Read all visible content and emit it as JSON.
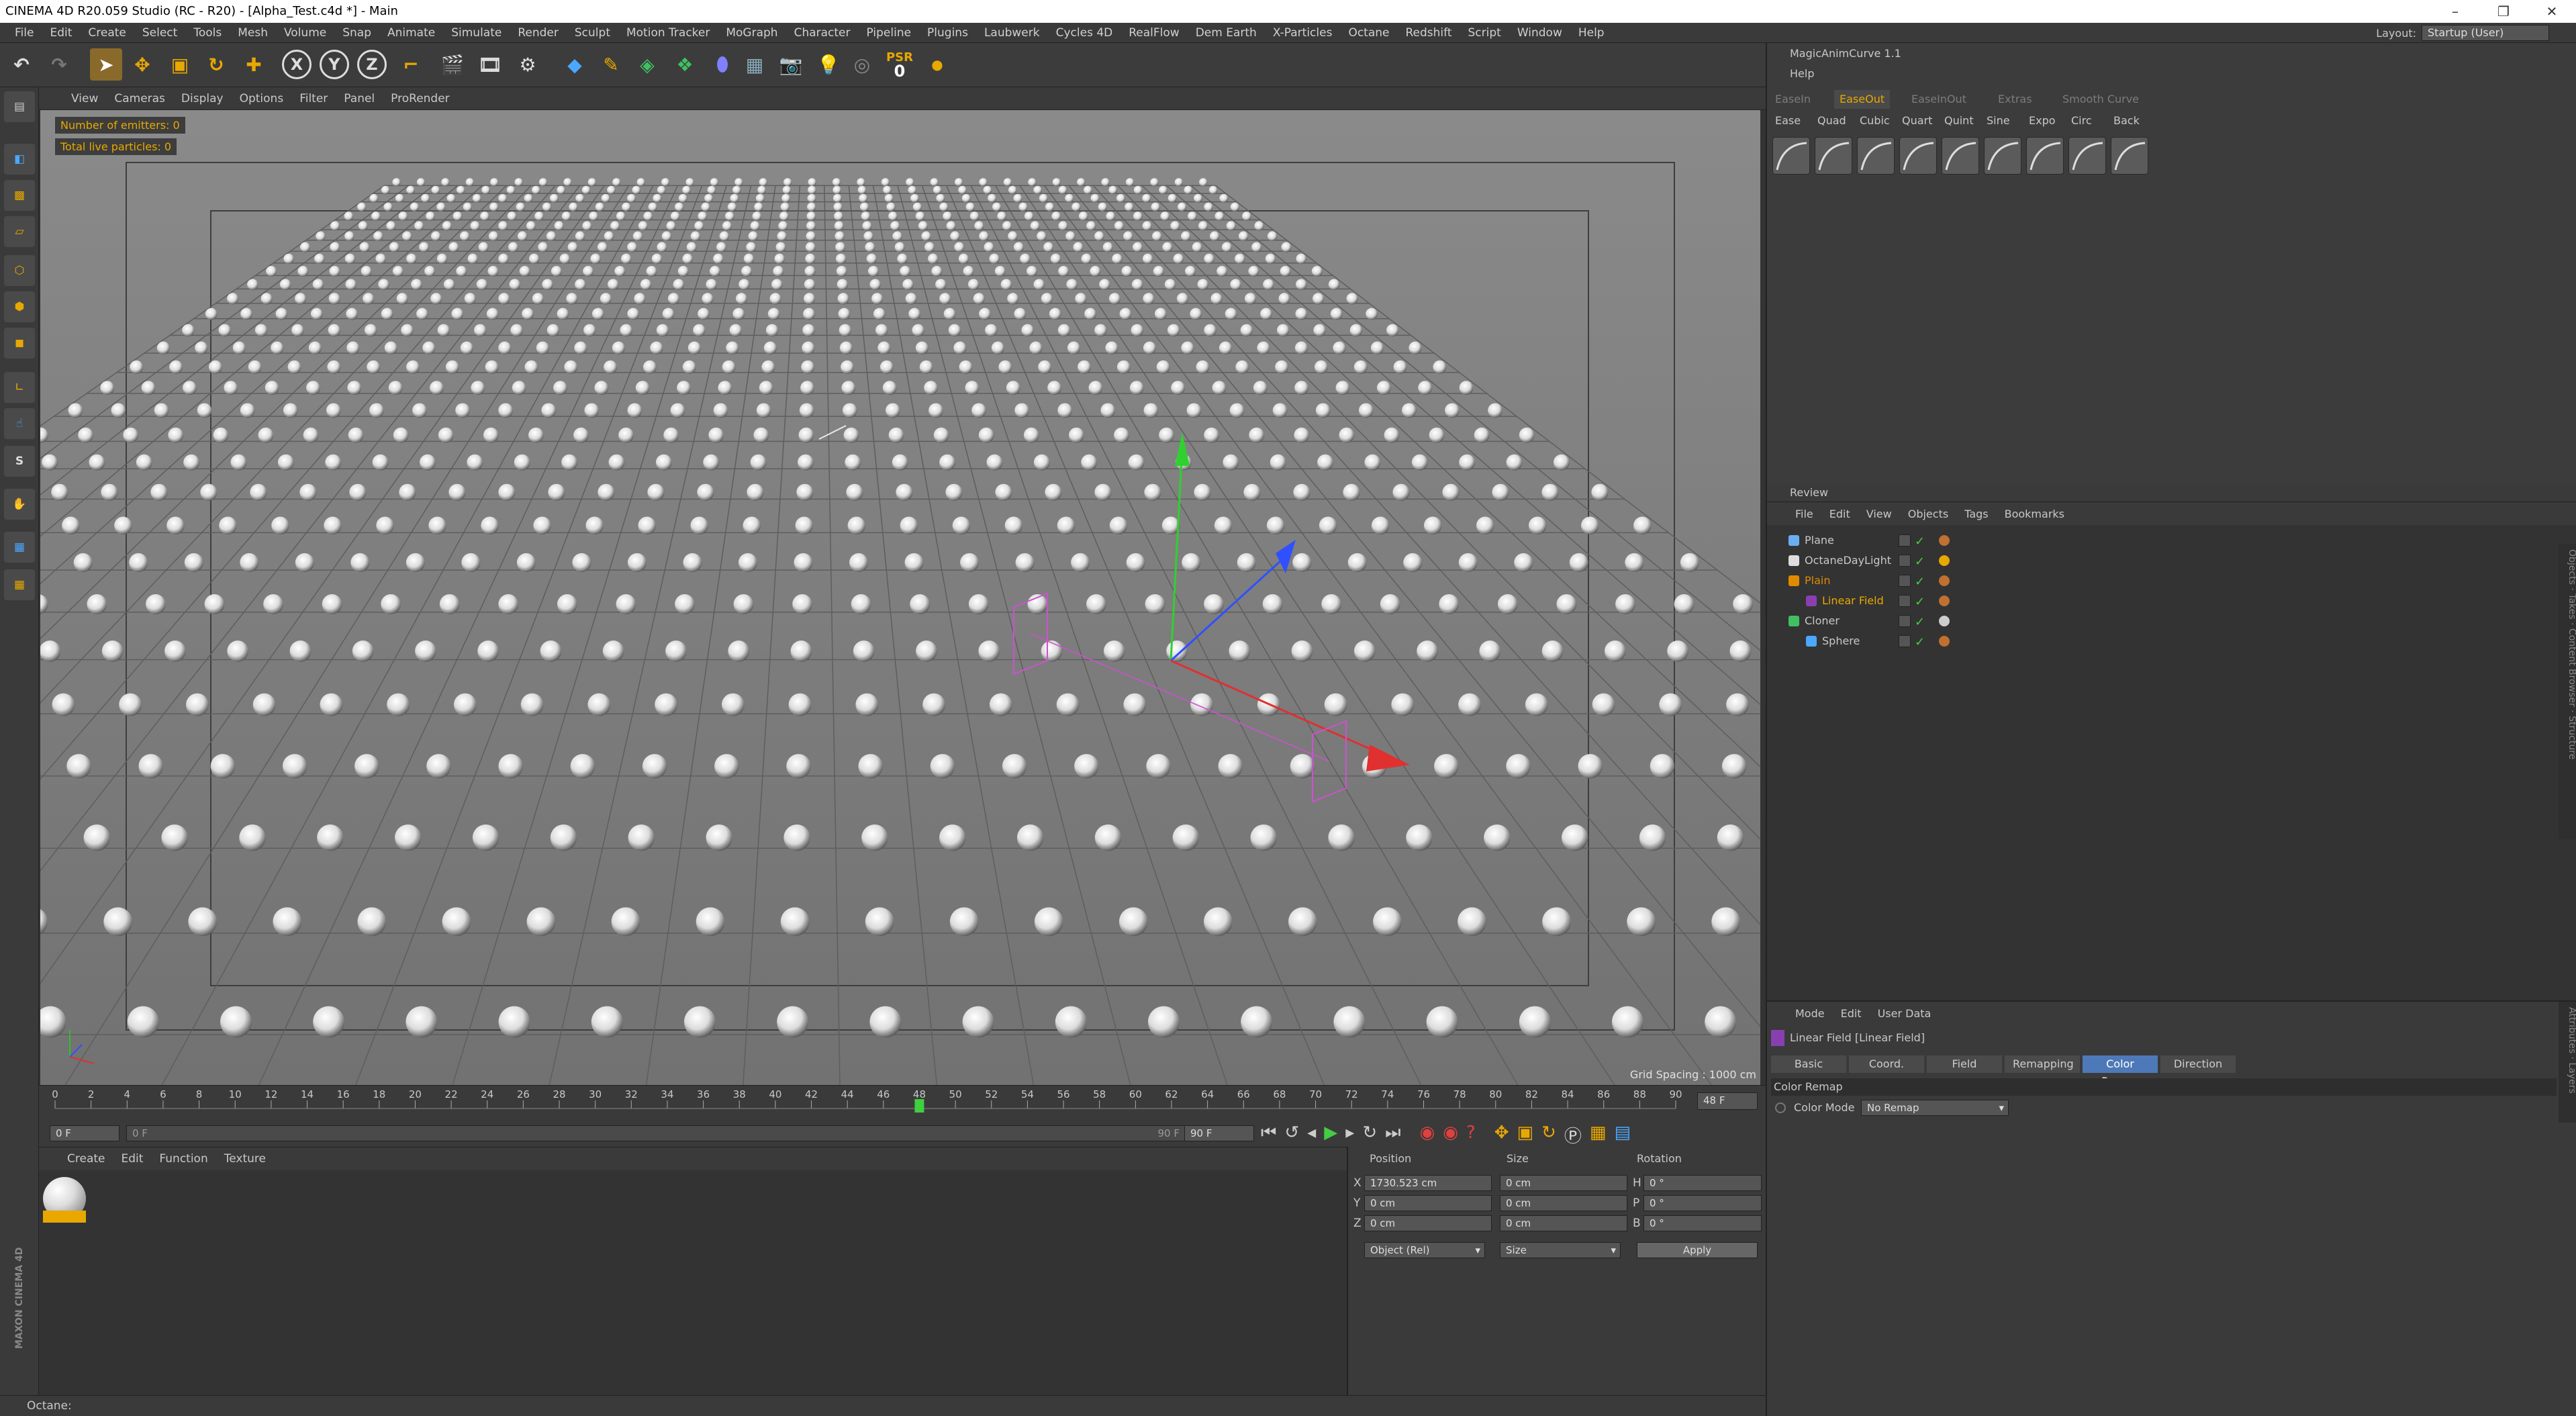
{
  "app": {
    "title": "CINEMA 4D R20.059 Studio (RC - R20) - [Alpha_Test.c4d *] - Main",
    "layout_label": "Layout:",
    "layout_value": "Startup (User)"
  },
  "menu": [
    "File",
    "Edit",
    "Create",
    "Select",
    "Tools",
    "Mesh",
    "Volume",
    "Snap",
    "Animate",
    "Simulate",
    "Render",
    "Sculpt",
    "Motion Tracker",
    "MoGraph",
    "Character",
    "Pipeline",
    "Plugins",
    "Laubwerk",
    "Cycles 4D",
    "RealFlow",
    "Dem Earth",
    "X-Particles",
    "Octane",
    "Redshift",
    "Script",
    "Window",
    "Help"
  ],
  "toolbar": {
    "psr_label": "PSR",
    "psr_value": "0"
  },
  "viewport": {
    "menu": [
      "View",
      "Cameras",
      "Display",
      "Options",
      "Filter",
      "Panel",
      "ProRender"
    ],
    "hud_emitters": "Number of emitters: 0",
    "hud_particles": "Total live particles: 0",
    "grid_spacing": "Grid Spacing : 1000 cm"
  },
  "timeline": {
    "ticks": [
      "0",
      "2",
      "4",
      "6",
      "8",
      "10",
      "12",
      "14",
      "16",
      "18",
      "20",
      "22",
      "24",
      "26",
      "28",
      "30",
      "32",
      "34",
      "36",
      "38",
      "40",
      "42",
      "44",
      "46",
      "48",
      "50",
      "52",
      "54",
      "56",
      "58",
      "60",
      "62",
      "64",
      "66",
      "68",
      "70",
      "72",
      "74",
      "76",
      "78",
      "80",
      "82",
      "84",
      "86",
      "88",
      "90"
    ],
    "current_frame_marker": "48",
    "end_frame_field": "48 F",
    "start_field": "0 F",
    "range_start": "0 F",
    "range_end": "90 F",
    "max_field": "90 F"
  },
  "material_panel": {
    "menu": [
      "Create",
      "Edit",
      "Function",
      "Texture"
    ]
  },
  "coords": {
    "headers": [
      "Position",
      "Size",
      "Rotation"
    ],
    "rows": [
      {
        "axis": "X",
        "pos": "1730.523 cm",
        "size": "0 cm",
        "rot_label": "H",
        "rot": "0 °"
      },
      {
        "axis": "Y",
        "pos": "0 cm",
        "size": "0 cm",
        "rot_label": "P",
        "rot": "0 °"
      },
      {
        "axis": "Z",
        "pos": "0 cm",
        "size": "0 cm",
        "rot_label": "B",
        "rot": "0 °"
      }
    ],
    "mode_select": "Object (Rel)",
    "size_select": "Size",
    "apply": "Apply"
  },
  "status": "Octane:",
  "magic": {
    "title": "MagicAnimCurve 1.1",
    "help": "Help",
    "tabs": [
      "EaseIn",
      "EaseOut",
      "EaseInOut",
      "Extras",
      "Smooth Curve"
    ],
    "active_tab": "EaseOut",
    "curve_names": [
      "Ease",
      "Quad",
      "Cubic",
      "Quart",
      "Quint",
      "Sine",
      "Expo",
      "Circ",
      "Back"
    ]
  },
  "objmgr": {
    "review": "Review",
    "menu": [
      "File",
      "Edit",
      "View",
      "Objects",
      "Tags",
      "Bookmarks"
    ],
    "objects": [
      {
        "name": "Plane",
        "color": "#c8c8c8"
      },
      {
        "name": "OctaneDayLight",
        "color": "#c8c8c8"
      },
      {
        "name": "Plain",
        "color": "#e08a00"
      },
      {
        "name": "Linear Field",
        "color": "#e8a800"
      },
      {
        "name": "Cloner",
        "color": "#c8c8c8"
      },
      {
        "name": "Sphere",
        "color": "#c8c8c8"
      }
    ],
    "side_tabs": [
      "Objects",
      "Takes",
      "Content Browser",
      "Structure"
    ]
  },
  "attributes": {
    "menu": [
      "Mode",
      "Edit",
      "User Data"
    ],
    "object_title": "Linear Field [Linear Field]",
    "tabs": [
      "Basic",
      "Coord.",
      "Field",
      "Remapping",
      "Color Remap",
      "Direction"
    ],
    "active_tab": "Color Remap",
    "section": "Color Remap",
    "color_mode_label": "Color Mode",
    "color_mode_value": "No Remap",
    "side_tabs": [
      "Attributes",
      "Layers"
    ]
  },
  "colors": {
    "accent_orange": "#e8a800",
    "active_tab": "#4e79b8",
    "axis_x": "#e02020",
    "axis_y": "#20c020",
    "axis_z": "#2040ff"
  }
}
